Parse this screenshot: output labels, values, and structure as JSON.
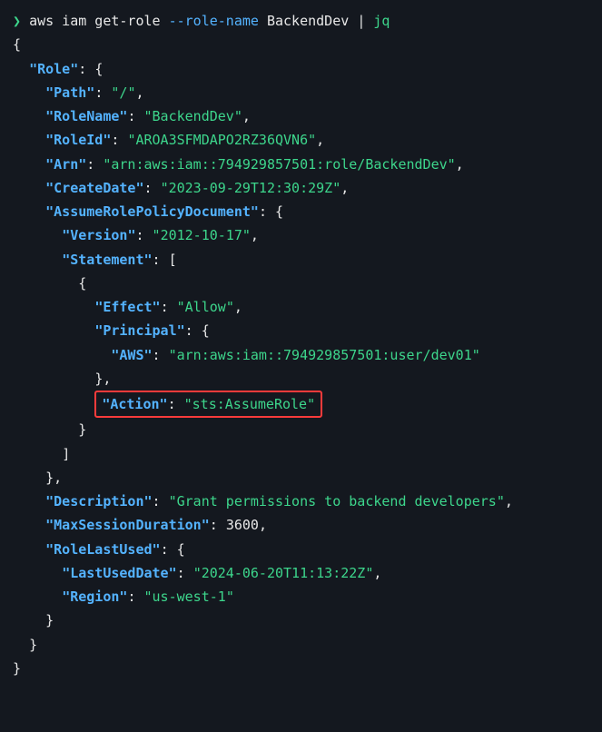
{
  "prompt": "❯",
  "command": {
    "cmd": "aws iam get-role",
    "flag": "--role-name",
    "arg": "BackendDev",
    "pipe": "|",
    "jq": "jq"
  },
  "out": {
    "Role": "Role",
    "Path": "Path",
    "PathVal": "/",
    "RoleName": "RoleName",
    "RoleNameVal": "BackendDev",
    "RoleId": "RoleId",
    "RoleIdVal": "AROA3SFMDAPO2RZ36QVN6",
    "Arn": "Arn",
    "ArnVal": "arn:aws:iam::794929857501:role/BackendDev",
    "CreateDate": "CreateDate",
    "CreateDateVal": "2023-09-29T12:30:29Z",
    "ARPD": "AssumeRolePolicyDocument",
    "Version": "Version",
    "VersionVal": "2012-10-17",
    "Statement": "Statement",
    "Effect": "Effect",
    "EffectVal": "Allow",
    "Principal": "Principal",
    "AWS": "AWS",
    "AWSVal": "arn:aws:iam::794929857501:user/dev01",
    "Action": "Action",
    "ActionVal": "sts:AssumeRole",
    "Description": "Description",
    "DescriptionVal": "Grant permissions to backend developers",
    "MaxSessionDuration": "MaxSessionDuration",
    "MaxSessionDurationVal": "3600",
    "RoleLastUsed": "RoleLastUsed",
    "LastUsedDate": "LastUsedDate",
    "LastUsedDateVal": "2024-06-20T11:13:22Z",
    "Region": "Region",
    "RegionVal": "us-west-1"
  }
}
